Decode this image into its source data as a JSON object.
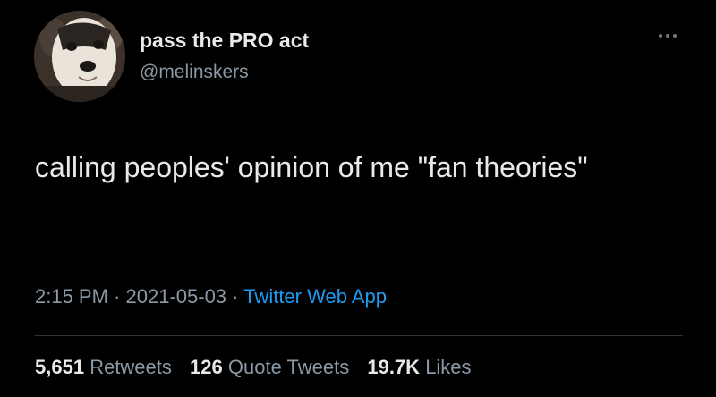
{
  "author": {
    "display_name": "pass the PRO act",
    "handle": "@melinskers",
    "avatar_icon": "husky-dog-avatar"
  },
  "tweet": {
    "text": "calling peoples' opinion of me \"fan theories\""
  },
  "meta": {
    "time": "2:15 PM",
    "separator": " · ",
    "date": "2021-05-03",
    "source": "Twitter Web App"
  },
  "stats": {
    "retweets_count": "5,651",
    "retweets_label": "Retweets",
    "quote_tweets_count": "126",
    "quote_tweets_label": "Quote Tweets",
    "likes_count": "19.7K",
    "likes_label": "Likes"
  },
  "menu": {
    "icon": "more-icon"
  },
  "colors": {
    "background": "#000000",
    "primary_text": "#e7e9ea",
    "secondary_text": "#8b98a5",
    "link": "#1d9bf0",
    "divider": "#2f3336"
  }
}
